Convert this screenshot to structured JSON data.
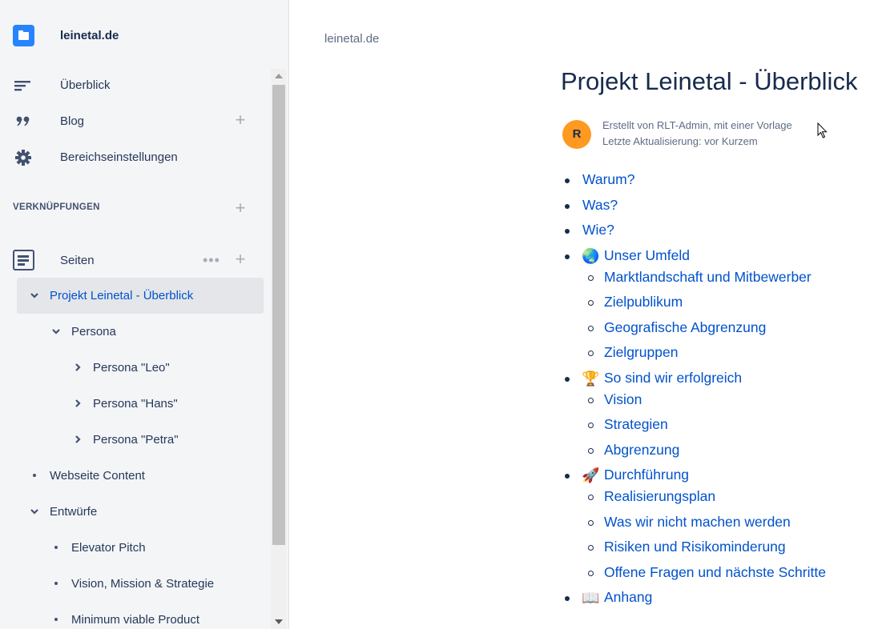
{
  "space": {
    "name": "leinetal.de"
  },
  "nav": {
    "overview": "Überblick",
    "blog": "Blog",
    "settings": "Bereichseinstellungen",
    "plus": "+"
  },
  "shortcuts": {
    "title": "VERKNÜPFUNGEN",
    "plus": "+"
  },
  "pages": {
    "label": "Seiten",
    "more": "•••",
    "plus": "+"
  },
  "tree": [
    {
      "label": "Projekt Leinetal - Überblick",
      "kind": "chevron-down",
      "selected": true
    },
    {
      "label": "Persona",
      "kind": "chevron-down"
    },
    {
      "label": "Persona \"Leo\"",
      "kind": "chevron-right"
    },
    {
      "label": "Persona \"Hans\"",
      "kind": "chevron-right"
    },
    {
      "label": "Persona \"Petra\"",
      "kind": "chevron-right"
    },
    {
      "label": "Webseite Content",
      "kind": "bullet"
    },
    {
      "label": "Entwürfe",
      "kind": "chevron-down"
    },
    {
      "label": "Elevator Pitch",
      "kind": "bullet"
    },
    {
      "label": "Vision, Mission & Strategie",
      "kind": "bullet"
    },
    {
      "label": "Minimum viable Product",
      "kind": "bullet"
    }
  ],
  "breadcrumb": "leinetal.de",
  "page": {
    "title": "Projekt Leinetal - Überblick",
    "avatar": "R",
    "created": "Erstellt von RLT-Admin, mit einer Vorlage",
    "updated": "Letzte Aktualisierung: vor Kurzem"
  },
  "toc": [
    {
      "label": "Warum?"
    },
    {
      "label": "Was?"
    },
    {
      "label": "Wie?"
    },
    {
      "label": "Unser Umfeld",
      "emoji": "🌏"
    },
    {
      "label": "Marktlandschaft und Mitbewerber",
      "sub": true
    },
    {
      "label": "Zielpublikum",
      "sub": true
    },
    {
      "label": "Geografische Abgrenzung",
      "sub": true
    },
    {
      "label": "Zielgruppen",
      "sub": true
    },
    {
      "label": "So sind wir erfolgreich",
      "emoji": "🏆"
    },
    {
      "label": "Vision",
      "sub": true
    },
    {
      "label": "Strategien",
      "sub": true
    },
    {
      "label": "Abgrenzung",
      "sub": true
    },
    {
      "label": "Durchführung",
      "emoji": "🚀"
    },
    {
      "label": "Realisierungsplan",
      "sub": true
    },
    {
      "label": "Was wir nicht machen werden",
      "sub": true
    },
    {
      "label": "Risiken und Risikominderung",
      "sub": true
    },
    {
      "label": "Offene Fragen und nächste Schritte",
      "sub": true
    },
    {
      "label": "Anhang",
      "emoji": "📖"
    }
  ]
}
